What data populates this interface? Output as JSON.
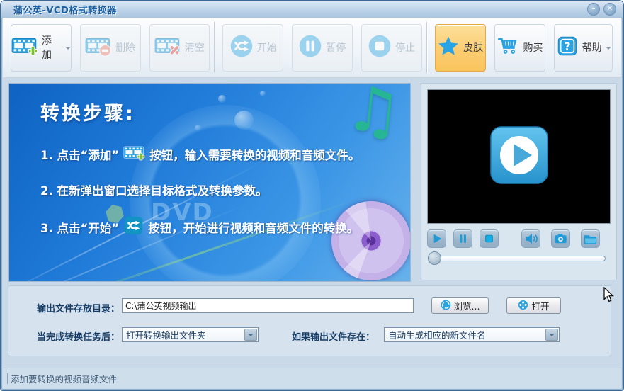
{
  "window": {
    "title": "蒲公英-VCD格式转换器",
    "minimize_glyph": "–",
    "close_glyph": "✕"
  },
  "toolbar": {
    "add_label": "添加",
    "delete_label": "删除",
    "clear_label": "清空",
    "start_label": "开始",
    "pause_label": "暂停",
    "stop_label": "停止",
    "skin_label": "皮肤",
    "buy_label": "购买",
    "help_label": "帮助"
  },
  "steps": {
    "heading": "转换步骤:",
    "step1_prefix": "1. 点击“添加”",
    "step1_suffix": "按钮，输入需要转换的视频和音频文件。",
    "step2": "2. 在新弹出窗口选择目标格式及转换参数。",
    "step3_prefix": "3. 点击“开始”",
    "step3_suffix": "按钮，开始进行视频和音频文件的转换。",
    "watermark": "DVD",
    "music_note_glyph": "♫"
  },
  "output_settings": {
    "dir_label": "输出文件存放目录：",
    "dir_value": "C:\\蒲公英视频输出",
    "browse_label": "浏览...",
    "open_label": "打开",
    "after_task_label": "当完成转换任务后：",
    "after_task_value": "打开转换输出文件夹",
    "if_exists_label": "如果输出文件存在：",
    "if_exists_value": "自动生成相应的新文件名"
  },
  "status_bar": {
    "text": "添加要转换的视频音频文件"
  },
  "colors": {
    "accent_blue": "#2aa3e0",
    "skin_button_orange": "#f9c45d",
    "panel_blue_top": "#0f63c2",
    "panel_blue_bottom": "#66b2ec",
    "disc_purple": "#6a35b5"
  }
}
